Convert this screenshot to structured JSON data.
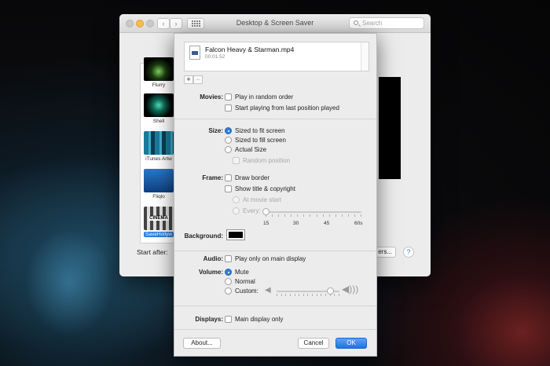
{
  "back_window": {
    "title": "Desktop & Screen Saver",
    "search_placeholder": "Search",
    "savers": [
      {
        "label": "Flurry"
      },
      {
        "label": "Shell"
      },
      {
        "label": "iTunes Artw"
      },
      {
        "label": "Fliqlo"
      },
      {
        "label": "SaveHollyw"
      }
    ],
    "cinema_text": "CINEMA",
    "start_after_label": "Start after:",
    "options_label": "ers...",
    "help_label": "?"
  },
  "sheet": {
    "file": {
      "name": "Falcon Heavy & Starman.mp4",
      "duration": "00:01:52"
    },
    "add_label": "+",
    "remove_label": "−",
    "movies": {
      "label": "Movies:",
      "random_order": "Play in random order",
      "resume": "Start playing from last position played"
    },
    "size": {
      "label": "Size:",
      "fit": "Sized to fit screen",
      "fill": "Sized to fill screen",
      "actual": "Actual Size",
      "random_position": "Random position"
    },
    "frame": {
      "label": "Frame:",
      "draw_border": "Draw border",
      "show_title": "Show title & copyright",
      "at_movie_start": "At movie start",
      "every": "Every:",
      "ticks": [
        "15",
        "30",
        "45",
        "60s"
      ]
    },
    "background": {
      "label": "Background:",
      "color": "#000000"
    },
    "audio": {
      "label": "Audio:",
      "main_only": "Play only on main display"
    },
    "volume": {
      "label": "Volume:",
      "mute": "Mute",
      "normal": "Normal",
      "custom": "Custom:",
      "level": 0.85
    },
    "displays": {
      "label": "Displays:",
      "main_only": "Main display only"
    },
    "about_label": "About...",
    "cancel_label": "Cancel",
    "ok_label": "OK"
  }
}
